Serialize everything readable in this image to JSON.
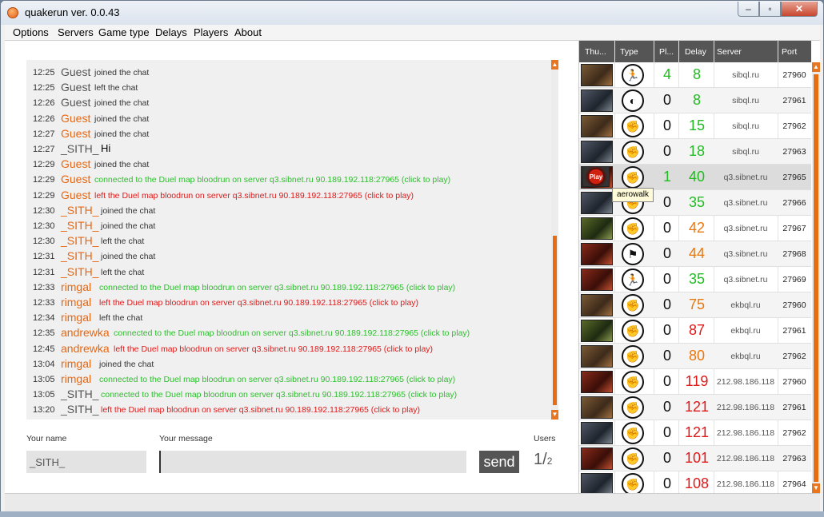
{
  "window": {
    "title": "quakerun ver. 0.0.43",
    "min_glyph": "–",
    "max_glyph": "▫",
    "close_glyph": "✕"
  },
  "menu": [
    "Options",
    "Servers",
    "Game type",
    "Delays",
    "Players",
    "About"
  ],
  "chat": [
    {
      "time": "12:25",
      "name": "Guest",
      "text": "joined the chat",
      "name_color": "#555555",
      "text_color": "#333333"
    },
    {
      "time": "12:25",
      "name": "Guest",
      "text": "left the chat",
      "name_color": "#555555",
      "text_color": "#333333"
    },
    {
      "time": "12:26",
      "name": "Guest",
      "text": "joined the chat",
      "name_color": "#555555",
      "text_color": "#333333"
    },
    {
      "time": "12:26",
      "name": "Guest",
      "text": "joined the chat",
      "name_color": "#e8660f",
      "text_color": "#333333"
    },
    {
      "time": "12:27",
      "name": "Guest",
      "text": "joined the chat",
      "name_color": "#e8660f",
      "text_color": "#333333"
    },
    {
      "time": "12:27",
      "name": "_SITH_",
      "text": "Hi",
      "name_color": "#555555",
      "text_color": "#000000"
    },
    {
      "time": "12:29",
      "name": "Guest",
      "text": "joined the chat",
      "name_color": "#e8660f",
      "text_color": "#333333"
    },
    {
      "time": "12:29",
      "name": "Guest",
      "text": "connected to the Duel map bloodrun on server q3.sibnet.ru 90.189.192.118:27965 (click to play)",
      "name_color": "#e8660f",
      "text_color": "#2bbf2b"
    },
    {
      "time": "12:29",
      "name": "Guest",
      "text": "left the Duel map bloodrun on server q3.sibnet.ru 90.189.192.118:27965 (click to play)",
      "name_color": "#e8660f",
      "text_color": "#e01818"
    },
    {
      "time": "12:30",
      "name": "_SITH_",
      "text": "joined the chat",
      "name_color": "#e8660f",
      "text_color": "#333333"
    },
    {
      "time": "12:30",
      "name": "_SITH_",
      "text": "joined the chat",
      "name_color": "#e8660f",
      "text_color": "#333333"
    },
    {
      "time": "12:30",
      "name": "_SITH_",
      "text": "left the chat",
      "name_color": "#e8660f",
      "text_color": "#333333"
    },
    {
      "time": "12:31",
      "name": "_SITH_",
      "text": "joined the chat",
      "name_color": "#e8660f",
      "text_color": "#333333"
    },
    {
      "time": "12:31",
      "name": "_SITH_",
      "text": "left the chat",
      "name_color": "#e8660f",
      "text_color": "#333333"
    },
    {
      "time": "12:33",
      "name": "rimgal",
      "text": "connected to the Duel map bloodrun on server q3.sibnet.ru 90.189.192.118:27965 (click to play)",
      "name_color": "#e8660f",
      "text_color": "#2bbf2b"
    },
    {
      "time": "12:33",
      "name": "rimgal",
      "text": "left the Duel map bloodrun on server q3.sibnet.ru 90.189.192.118:27965 (click to play)",
      "name_color": "#e8660f",
      "text_color": "#e01818"
    },
    {
      "time": "12:34",
      "name": "rimgal",
      "text": "left the chat",
      "name_color": "#e8660f",
      "text_color": "#333333"
    },
    {
      "time": "12:35",
      "name": "andrewka",
      "text": "connected to the Duel map bloodrun on server q3.sibnet.ru 90.189.192.118:27965 (click to play)",
      "name_color": "#e8660f",
      "text_color": "#2bbf2b"
    },
    {
      "time": "12:45",
      "name": "andrewka",
      "text": "left the Duel map bloodrun on server q3.sibnet.ru 90.189.192.118:27965 (click to play)",
      "name_color": "#e8660f",
      "text_color": "#e01818"
    },
    {
      "time": "13:04",
      "name": "rimgal",
      "text": "joined the chat",
      "name_color": "#e8660f",
      "text_color": "#333333"
    },
    {
      "time": "13:05",
      "name": "rimgal",
      "text": "connected to the Duel map bloodrun on server q3.sibnet.ru 90.189.192.118:27965 (click to play)",
      "name_color": "#e8660f",
      "text_color": "#2bbf2b"
    },
    {
      "time": "13:05",
      "name": "_SITH_",
      "text": "connected to the Duel map bloodrun on server q3.sibnet.ru 90.189.192.118:27965 (click to play)",
      "name_color": "#555555",
      "text_color": "#2bbf2b"
    },
    {
      "time": "13:20",
      "name": "_SITH_",
      "text": "left the Duel map bloodrun on server q3.sibnet.ru 90.189.192.118:27965 (click to play)",
      "name_color": "#555555",
      "text_color": "#e01818"
    }
  ],
  "form": {
    "name_label": "Your name",
    "message_label": "Your message",
    "users_label": "Users",
    "name_value": "_SITH_",
    "message_value": "",
    "send_label": "send",
    "users_count": "1",
    "users_total": "2"
  },
  "grid": {
    "headers": [
      "Thu...",
      "Type",
      "Pl...",
      "Delay",
      "Server",
      "Port"
    ],
    "play_label": "Play",
    "tooltip": "aerowalk",
    "rows": [
      {
        "thumb": "t1",
        "type_icon": "runner-icon",
        "players": "4",
        "delay": "8",
        "server": "sibql.ru",
        "port": "27960",
        "pl_color": "#22bb22",
        "delay_color": "#22bb22"
      },
      {
        "thumb": "t2",
        "type_icon": "half-disc-icon",
        "players": "0",
        "delay": "8",
        "server": "sibql.ru",
        "port": "27961",
        "pl_color": "#111111",
        "delay_color": "#22bb22"
      },
      {
        "thumb": "t1",
        "type_icon": "fist-icon",
        "players": "0",
        "delay": "15",
        "server": "sibql.ru",
        "port": "27962",
        "pl_color": "#111111",
        "delay_color": "#22bb22"
      },
      {
        "thumb": "t2",
        "type_icon": "fist-icon",
        "players": "0",
        "delay": "18",
        "server": "sibql.ru",
        "port": "27963",
        "pl_color": "#111111",
        "delay_color": "#22bb22"
      },
      {
        "thumb": "t4",
        "type_icon": "fist-icon",
        "players": "1",
        "delay": "40",
        "server": "q3.sibnet.ru",
        "port": "27965",
        "pl_color": "#22bb22",
        "delay_color": "#22bb22"
      },
      {
        "thumb": "t2",
        "type_icon": "fist-icon",
        "players": "0",
        "delay": "35",
        "server": "q3.sibnet.ru",
        "port": "27966",
        "pl_color": "#111111",
        "delay_color": "#22bb22"
      },
      {
        "thumb": "t3",
        "type_icon": "fist-icon",
        "players": "0",
        "delay": "42",
        "server": "q3.sibnet.ru",
        "port": "27967",
        "pl_color": "#111111",
        "delay_color": "#e8770f"
      },
      {
        "thumb": "t4",
        "type_icon": "flag-icon",
        "players": "0",
        "delay": "44",
        "server": "q3.sibnet.ru",
        "port": "27968",
        "pl_color": "#111111",
        "delay_color": "#e8770f"
      },
      {
        "thumb": "t4",
        "type_icon": "runner-icon",
        "players": "0",
        "delay": "35",
        "server": "q3.sibnet.ru",
        "port": "27969",
        "pl_color": "#111111",
        "delay_color": "#22bb22"
      },
      {
        "thumb": "t1",
        "type_icon": "fist-icon",
        "players": "0",
        "delay": "75",
        "server": "ekbql.ru",
        "port": "27960",
        "pl_color": "#111111",
        "delay_color": "#e8770f"
      },
      {
        "thumb": "t3",
        "type_icon": "fist-icon",
        "players": "0",
        "delay": "87",
        "server": "ekbql.ru",
        "port": "27961",
        "pl_color": "#111111",
        "delay_color": "#e01818"
      },
      {
        "thumb": "t1",
        "type_icon": "fist-icon",
        "players": "0",
        "delay": "80",
        "server": "ekbql.ru",
        "port": "27962",
        "pl_color": "#111111",
        "delay_color": "#e8770f"
      },
      {
        "thumb": "t4",
        "type_icon": "fist-icon",
        "players": "0",
        "delay": "119",
        "server": "212.98.186.118",
        "port": "27960",
        "pl_color": "#111111",
        "delay_color": "#e01818"
      },
      {
        "thumb": "t1",
        "type_icon": "fist-icon",
        "players": "0",
        "delay": "121",
        "server": "212.98.186.118",
        "port": "27961",
        "pl_color": "#111111",
        "delay_color": "#e01818"
      },
      {
        "thumb": "t2",
        "type_icon": "fist-icon",
        "players": "0",
        "delay": "121",
        "server": "212.98.186.118",
        "port": "27962",
        "pl_color": "#111111",
        "delay_color": "#e01818"
      },
      {
        "thumb": "t4",
        "type_icon": "fist-icon",
        "players": "0",
        "delay": "101",
        "server": "212.98.186.118",
        "port": "27963",
        "pl_color": "#111111",
        "delay_color": "#e01818"
      },
      {
        "thumb": "t2",
        "type_icon": "fist-icon",
        "players": "0",
        "delay": "108",
        "server": "212.98.186.118",
        "port": "27964",
        "pl_color": "#111111",
        "delay_color": "#e01818"
      }
    ]
  }
}
